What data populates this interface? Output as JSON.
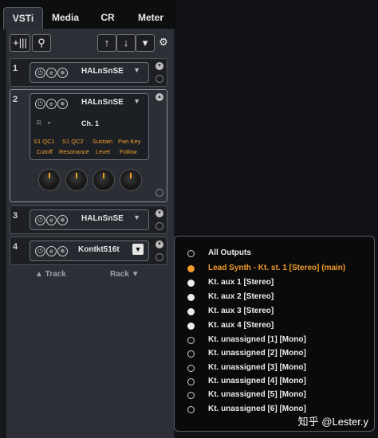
{
  "tabs": [
    {
      "label": "VSTi",
      "active": true
    },
    {
      "label": "Media",
      "active": false
    },
    {
      "label": "CR",
      "active": false
    },
    {
      "label": "Meter",
      "active": false
    }
  ],
  "toolbar": {
    "add_icon": "add-instrument-icon",
    "search_icon": "search-icon",
    "up_icon": "arrow-up-icon",
    "down_icon": "arrow-down-icon",
    "collapse_icon": "collapse-icon",
    "settings_icon": "gear-icon"
  },
  "slots": [
    {
      "number": "1",
      "plugin": "HALnSnSE"
    },
    {
      "number": "2",
      "plugin": "HALnSnSE",
      "channel": "Ch. 1",
      "quick_controls": [
        {
          "top": "S1 QC1",
          "bottom": "Cutoff"
        },
        {
          "top": "S1 QC2",
          "bottom": "Resonance"
        },
        {
          "top": "Sustain",
          "bottom": "Level"
        },
        {
          "top": "Pan Key",
          "bottom": "Follow"
        }
      ],
      "record_label": "R",
      "monitor_label": "▪"
    },
    {
      "number": "3",
      "plugin": "HALnSnSE"
    },
    {
      "number": "4",
      "plugin": "Kontkt516t"
    }
  ],
  "footer": {
    "track_label": "▲ Track",
    "rack_label": "Rack ▼"
  },
  "outputs_menu": {
    "items": [
      {
        "label": "All Outputs",
        "state": "ring"
      },
      {
        "label": "Lead Synth - Kt. st. 1 [Stereo] (main)",
        "state": "orange"
      },
      {
        "label": "Kt. aux 1 [Stereo]",
        "state": "filled"
      },
      {
        "label": "Kt. aux 2 [Stereo]",
        "state": "filled"
      },
      {
        "label": "Kt. aux 3 [Stereo]",
        "state": "filled"
      },
      {
        "label": "Kt. aux 4 [Stereo]",
        "state": "filled"
      },
      {
        "label": "Kt.  unassigned [1] [Mono]",
        "state": "ring"
      },
      {
        "label": "Kt.  unassigned [2] [Mono]",
        "state": "ring"
      },
      {
        "label": "Kt.  unassigned [3] [Mono]",
        "state": "ring"
      },
      {
        "label": "Kt.  unassigned [4] [Mono]",
        "state": "ring"
      },
      {
        "label": "Kt.  unassigned [5] [Mono]",
        "state": "ring"
      },
      {
        "label": "Kt.  unassigned [6] [Mono]",
        "state": "ring"
      }
    ],
    "accent": "#f29b2a"
  },
  "watermark": "知乎 @Lester.y"
}
